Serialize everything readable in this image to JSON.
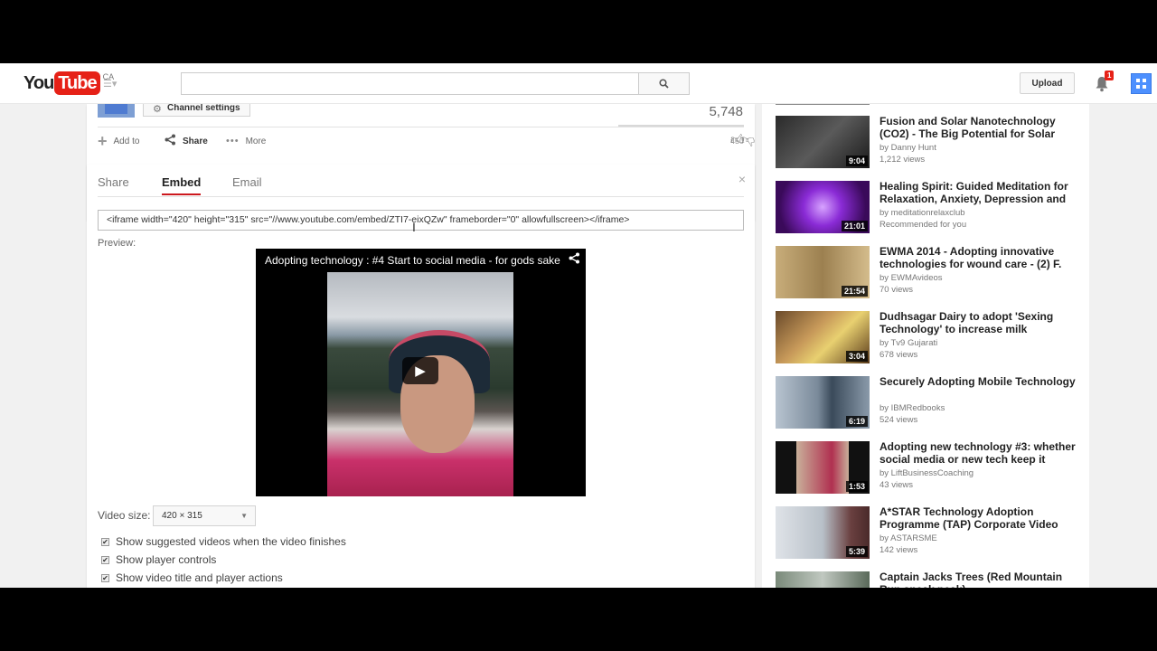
{
  "masthead": {
    "logo_you": "You",
    "logo_tube": "Tube",
    "country_code": "CA",
    "search_placeholder": "",
    "upload_label": "Upload",
    "notification_count": "1"
  },
  "owner": {
    "channel_settings_label": "Channel settings",
    "view_count": "5,748",
    "add_to_label": "Add to",
    "share_label": "Share",
    "more_label": "More",
    "likes": "45",
    "dislikes": "0"
  },
  "share_panel": {
    "tabs": [
      {
        "label": "Share"
      },
      {
        "label": "Embed"
      },
      {
        "label": "Email"
      }
    ],
    "active_tab": "Embed",
    "embed_code": "<iframe width=\"420\" height=\"315\" src=\"//www.youtube.com/embed/ZTI7-eixQZw\" frameborder=\"0\" allowfullscreen></iframe>",
    "preview_label": "Preview:",
    "player_title": "Adopting technology : #4 Start to social media - for gods sake...",
    "video_size_label": "Video size:",
    "video_size_value": "420 × 315",
    "options": [
      {
        "label": "Show suggested videos when the video finishes",
        "checked": true
      },
      {
        "label": "Show player controls",
        "checked": true
      },
      {
        "label": "Show video title and player actions",
        "checked": true
      }
    ]
  },
  "related": [
    {
      "title": "Fusion and Solar Nanotechnology (CO2) - The Big Potential for Solar",
      "channel": "by Danny Hunt",
      "views": "1,212 views",
      "duration": "9:04",
      "thumb_color": "#3c3c3c"
    },
    {
      "title": "Healing Spirit: Guided Meditation for Relaxation, Anxiety, Depression and",
      "channel": "by meditationrelaxclub",
      "views": "Recommended for you",
      "duration": "21:01",
      "thumb_color": "#6a1f8a"
    },
    {
      "title": "EWMA 2014 - Adopting innovative technologies for wound care - (2) F.",
      "channel": "by EWMAvideos",
      "views": "70 views",
      "duration": "21:54",
      "thumb_color": "#b89b6e"
    },
    {
      "title": "Dudhsagar Dairy to adopt 'Sexing Technology' to increase milk",
      "channel": "by Tv9 Gujarati",
      "views": "678 views",
      "duration": "3:04",
      "thumb_color": "#8a6a3a"
    },
    {
      "title": "Securely Adopting Mobile Technology",
      "channel": "by IBMRedbooks",
      "views": "524 views",
      "duration": "6:19",
      "thumb_color": "#5a6a7a"
    },
    {
      "title": "Adopting new technology #3: whether social media or new tech keep it social",
      "channel": "by LiftBusinessCoaching",
      "views": "43 views",
      "duration": "1:53",
      "thumb_color": "#2a2a2a"
    },
    {
      "title": "A*STAR Technology Adoption Programme (TAP) Corporate Video",
      "channel": "by ASTARSME",
      "views": "142 views",
      "duration": "5:39",
      "thumb_color": "#9aa4ae"
    },
    {
      "title": "Captain Jacks Trees (Red Mountain Run sneak peak)",
      "channel": "",
      "views": "",
      "duration": "",
      "thumb_color": "#6a7a6a"
    }
  ]
}
